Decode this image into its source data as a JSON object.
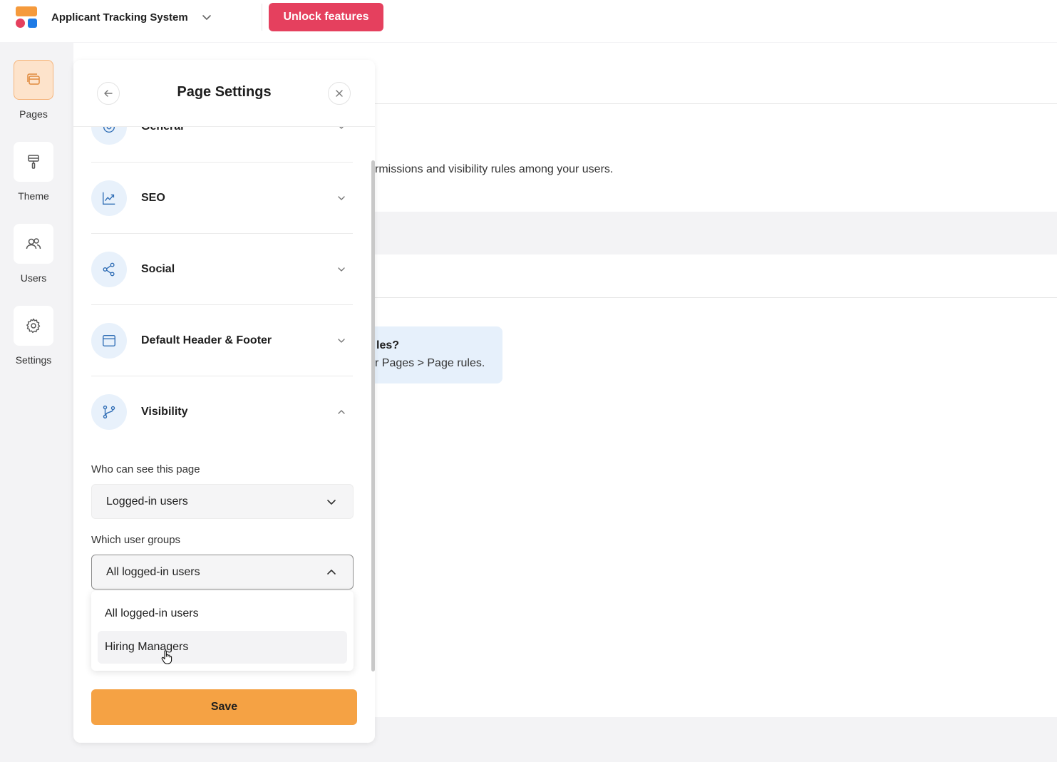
{
  "topbar": {
    "app_title": "Applicant Tracking System",
    "unlock_label": "Unlock features"
  },
  "rail": {
    "items": [
      {
        "label": "Pages",
        "icon": "pages-icon",
        "active": true
      },
      {
        "label": "Theme",
        "icon": "paint-roller-icon",
        "active": false
      },
      {
        "label": "Users",
        "icon": "users-icon",
        "active": false
      },
      {
        "label": "Settings",
        "icon": "gear-icon",
        "active": false
      }
    ]
  },
  "main": {
    "description_fragment": "rmissions and visibility rules among your users.",
    "info_title_fragment": "les?",
    "info_text_fragment": "r Pages > Page rules."
  },
  "panel": {
    "title": "Page Settings",
    "sections": [
      {
        "label": "General",
        "icon": "gear-icon",
        "expanded": false
      },
      {
        "label": "SEO",
        "icon": "chart-line-icon",
        "expanded": false
      },
      {
        "label": "Social",
        "icon": "share-icon",
        "expanded": false
      },
      {
        "label": "Default Header & Footer",
        "icon": "layout-icon",
        "expanded": false
      },
      {
        "label": "Visibility",
        "icon": "branch-icon",
        "expanded": true
      }
    ],
    "visibility": {
      "who_label": "Who can see this page",
      "who_value": "Logged-in users",
      "groups_label": "Which user groups",
      "groups_value": "All logged-in users",
      "groups_options": [
        "All logged-in users",
        "Hiring Managers"
      ],
      "hovered_option": "Hiring Managers"
    },
    "save_label": "Save"
  },
  "colors": {
    "brand_orange": "#f59a3c",
    "brand_red": "#e5405e",
    "brand_blue": "#1e7be6",
    "save_button": "#f5a244",
    "icon_blue": "#2f6db5",
    "icon_bg": "#e8f1fb"
  }
}
